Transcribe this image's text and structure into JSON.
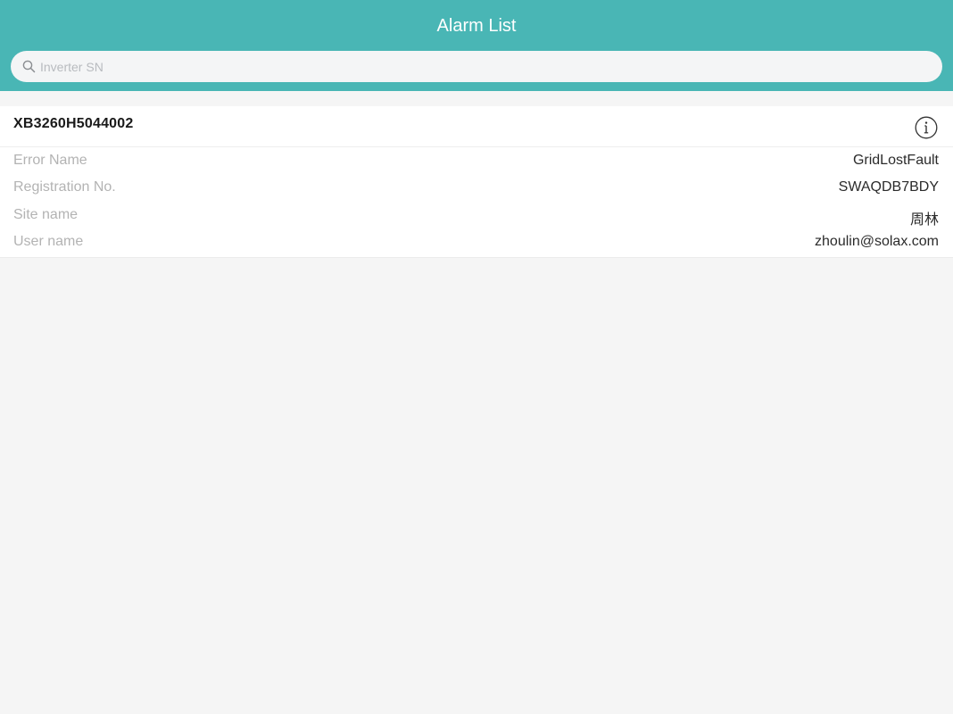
{
  "header": {
    "title": "Alarm List",
    "background_color": "#49b6b5"
  },
  "search": {
    "icon": "search-icon",
    "placeholder": "Inverter SN",
    "value": ""
  },
  "alarms": [
    {
      "serial_number": "XB3260H5044002",
      "info_icon": "info-circle-icon",
      "fields": [
        {
          "label": "Error Name",
          "value": "GridLostFault"
        },
        {
          "label": "Registration No.",
          "value": "SWAQDB7BDY"
        },
        {
          "label": "Site name",
          "value": "周林"
        },
        {
          "label": "User name",
          "value": "zhoulin@solax.com"
        }
      ]
    }
  ]
}
